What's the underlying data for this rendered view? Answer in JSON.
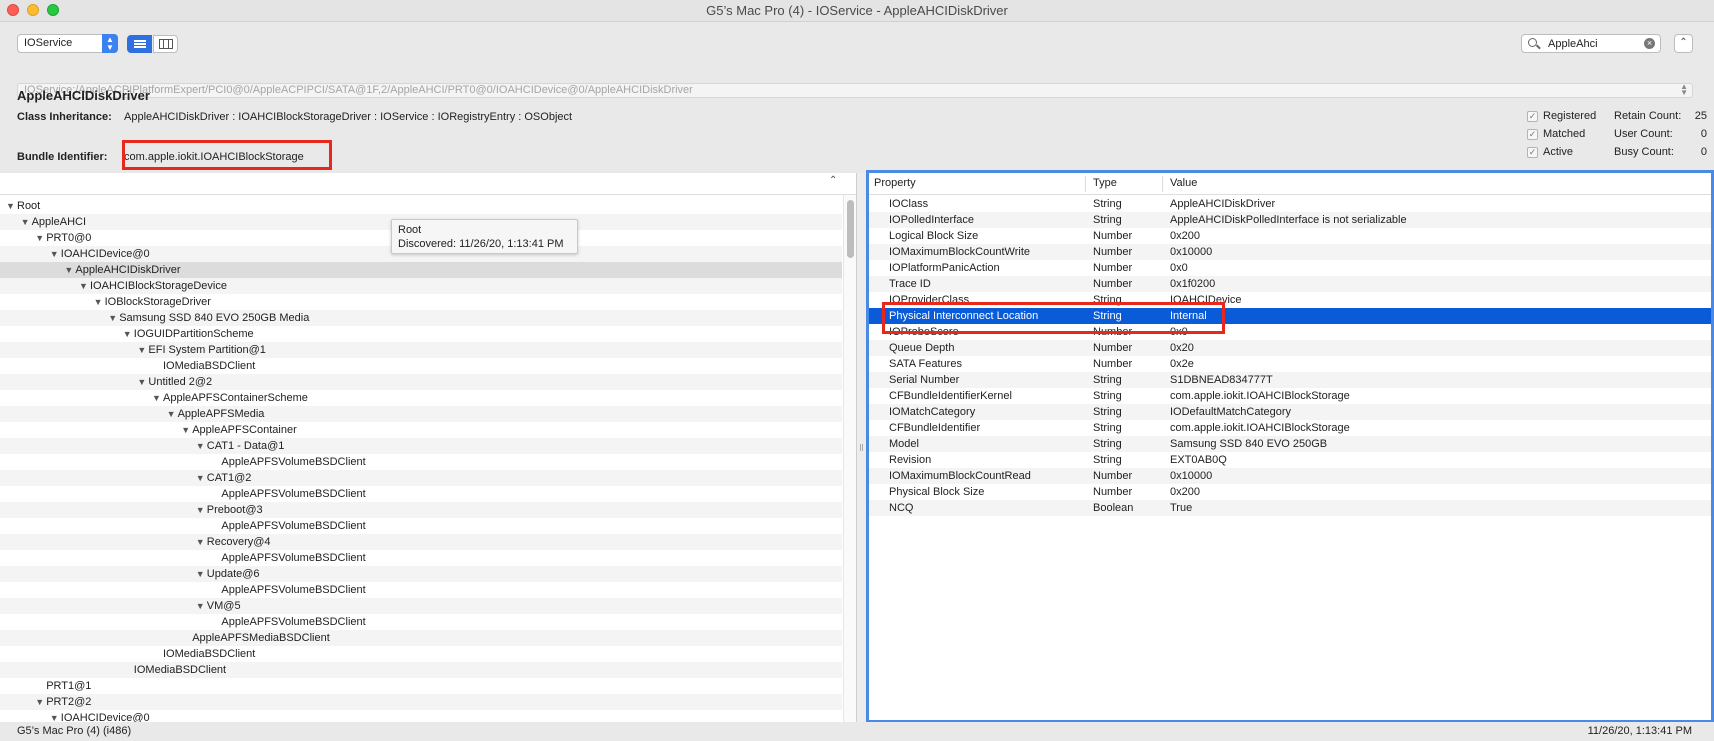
{
  "window": {
    "title": "G5’s Mac Pro (4) - IOService - AppleAHCIDiskDriver"
  },
  "toolbar": {
    "plane_select": "IOService",
    "search_value": "AppleAhci",
    "path": "IOService:/AppleACPIPlatformExpert/PCI0@0/AppleACPIPCI/SATA@1F,2/AppleAHCI/PRT0@0/IOAHCIDevice@0/AppleAHCIDiskDriver"
  },
  "info": {
    "class_name": "AppleAHCIDiskDriver",
    "inheritance_label": "Class Inheritance:",
    "inheritance_value": "AppleAHCIDiskDriver : IOAHCIBlockStorageDriver : IOService : IORegistryEntry : OSObject",
    "bundle_label": "Bundle Identifier:",
    "bundle_value": "com.apple.iokit.IOAHCIBlockStorage",
    "flags": [
      {
        "label": "Registered",
        "checked": true,
        "count_label": "Retain Count:",
        "count": "25"
      },
      {
        "label": "Matched",
        "checked": true,
        "count_label": "User Count:",
        "count": "0"
      },
      {
        "label": "Active",
        "checked": true,
        "count_label": "Busy Count:",
        "count": "0"
      }
    ]
  },
  "tree": [
    {
      "label": "Root",
      "depth": 0,
      "expanded": true
    },
    {
      "label": "AppleAHCI",
      "depth": 1,
      "expanded": true
    },
    {
      "label": "PRT0@0",
      "depth": 2,
      "expanded": true
    },
    {
      "label": "IOAHCIDevice@0",
      "depth": 3,
      "expanded": true
    },
    {
      "label": "AppleAHCIDiskDriver",
      "depth": 4,
      "expanded": true,
      "selected": true
    },
    {
      "label": "IOAHCIBlockStorageDevice",
      "depth": 5,
      "expanded": true
    },
    {
      "label": "IOBlockStorageDriver",
      "depth": 6,
      "expanded": true
    },
    {
      "label": "Samsung SSD 840 EVO 250GB Media",
      "depth": 7,
      "expanded": true
    },
    {
      "label": "IOGUIDPartitionScheme",
      "depth": 8,
      "expanded": true
    },
    {
      "label": "EFI System Partition@1",
      "depth": 9,
      "expanded": true
    },
    {
      "label": "IOMediaBSDClient",
      "depth": 10,
      "expanded": false
    },
    {
      "label": "Untitled 2@2",
      "depth": 9,
      "expanded": true
    },
    {
      "label": "AppleAPFSContainerScheme",
      "depth": 10,
      "expanded": true
    },
    {
      "label": "AppleAPFSMedia",
      "depth": 11,
      "expanded": true
    },
    {
      "label": "AppleAPFSContainer",
      "depth": 12,
      "expanded": true
    },
    {
      "label": "CAT1 - Data@1",
      "depth": 13,
      "expanded": true
    },
    {
      "label": "AppleAPFSVolumeBSDClient",
      "depth": 14,
      "expanded": false
    },
    {
      "label": "CAT1@2",
      "depth": 13,
      "expanded": true
    },
    {
      "label": "AppleAPFSVolumeBSDClient",
      "depth": 14,
      "expanded": false
    },
    {
      "label": "Preboot@3",
      "depth": 13,
      "expanded": true
    },
    {
      "label": "AppleAPFSVolumeBSDClient",
      "depth": 14,
      "expanded": false
    },
    {
      "label": "Recovery@4",
      "depth": 13,
      "expanded": true
    },
    {
      "label": "AppleAPFSVolumeBSDClient",
      "depth": 14,
      "expanded": false
    },
    {
      "label": "Update@6",
      "depth": 13,
      "expanded": true
    },
    {
      "label": "AppleAPFSVolumeBSDClient",
      "depth": 14,
      "expanded": false
    },
    {
      "label": "VM@5",
      "depth": 13,
      "expanded": true
    },
    {
      "label": "AppleAPFSVolumeBSDClient",
      "depth": 14,
      "expanded": false
    },
    {
      "label": "AppleAPFSMediaBSDClient",
      "depth": 12,
      "expanded": false
    },
    {
      "label": "IOMediaBSDClient",
      "depth": 10,
      "expanded": false
    },
    {
      "label": "IOMediaBSDClient",
      "depth": 8,
      "expanded": false
    },
    {
      "label": "PRT1@1",
      "depth": 2,
      "expanded": false
    },
    {
      "label": "PRT2@2",
      "depth": 2,
      "expanded": true
    },
    {
      "label": "IOAHCIDevice@0",
      "depth": 3,
      "expanded": true
    }
  ],
  "tooltip": {
    "title": "Root",
    "discovered": "Discovered: 11/26/20, 1:13:41 PM"
  },
  "properties": {
    "columns": [
      "Property",
      "Type",
      "Value"
    ],
    "rows": [
      {
        "property": "IOClass",
        "type": "String",
        "value": "AppleAHCIDiskDriver"
      },
      {
        "property": "IOPolledInterface",
        "type": "String",
        "value": "AppleAHCIDiskPolledInterface is not serializable"
      },
      {
        "property": "Logical Block Size",
        "type": "Number",
        "value": "0x200"
      },
      {
        "property": "IOMaximumBlockCountWrite",
        "type": "Number",
        "value": "0x10000"
      },
      {
        "property": "IOPlatformPanicAction",
        "type": "Number",
        "value": "0x0"
      },
      {
        "property": "Trace ID",
        "type": "Number",
        "value": "0x1f0200"
      },
      {
        "property": "IOProviderClass",
        "type": "String",
        "value": "IOAHCIDevice"
      },
      {
        "property": "Physical Interconnect Location",
        "type": "String",
        "value": "Internal",
        "selected": true
      },
      {
        "property": "IOProbeScore",
        "type": "Number",
        "value": "0x0"
      },
      {
        "property": "Queue Depth",
        "type": "Number",
        "value": "0x20"
      },
      {
        "property": "SATA Features",
        "type": "Number",
        "value": "0x2e"
      },
      {
        "property": "Serial Number",
        "type": "String",
        "value": "S1DBNEAD834777T"
      },
      {
        "property": "CFBundleIdentifierKernel",
        "type": "String",
        "value": "com.apple.iokit.IOAHCIBlockStorage"
      },
      {
        "property": "IOMatchCategory",
        "type": "String",
        "value": "IODefaultMatchCategory"
      },
      {
        "property": "CFBundleIdentifier",
        "type": "String",
        "value": "com.apple.iokit.IOAHCIBlockStorage"
      },
      {
        "property": "Model",
        "type": "String",
        "value": "Samsung SSD 840 EVO 250GB"
      },
      {
        "property": "Revision",
        "type": "String",
        "value": "EXT0AB0Q"
      },
      {
        "property": "IOMaximumBlockCountRead",
        "type": "Number",
        "value": "0x10000"
      },
      {
        "property": "Physical Block Size",
        "type": "Number",
        "value": "0x200"
      },
      {
        "property": "NCQ",
        "type": "Boolean",
        "value": "True"
      }
    ]
  },
  "status": {
    "machine": "G5’s Mac Pro (4) (i486)",
    "timestamp": "11/26/20, 1:13:41 PM"
  },
  "colors": {
    "selection": "#0a5bd8",
    "focus_ring": "#4a89e5",
    "annotation": "#e8271d"
  }
}
